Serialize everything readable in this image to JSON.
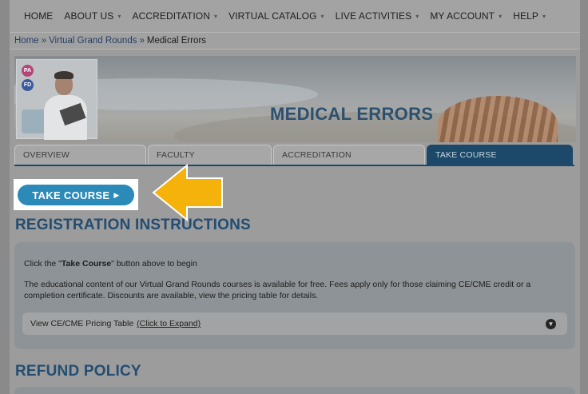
{
  "nav": {
    "items": [
      {
        "label": "HOME",
        "caret": false
      },
      {
        "label": "ABOUT US",
        "caret": true
      },
      {
        "label": "ACCREDITATION",
        "caret": true
      },
      {
        "label": "VIRTUAL CATALOG",
        "caret": true
      },
      {
        "label": "LIVE ACTIVITIES",
        "caret": true
      },
      {
        "label": "MY ACCOUNT",
        "caret": true
      },
      {
        "label": "HELP",
        "caret": true
      }
    ],
    "caret_glyph": "▾"
  },
  "breadcrumb": {
    "home": "Home",
    "section": "Virtual Grand Rounds",
    "current": "Medical Errors",
    "separator": "»"
  },
  "banner": {
    "title": "MEDICAL ERRORS",
    "badge1": "PA",
    "badge2": "FD"
  },
  "tabs": [
    {
      "label": "OVERVIEW",
      "active": false
    },
    {
      "label": "FACULTY",
      "active": false
    },
    {
      "label": "ACCREDITATION",
      "active": false
    },
    {
      "label": "TAKE COURSE",
      "active": true
    }
  ],
  "take_course_button": {
    "label": "TAKE COURSE",
    "arrow": "▶"
  },
  "registration": {
    "title": "REGISTRATION INSTRUCTIONS",
    "line1_prefix": "Click the \"",
    "line1_bold": "Take Course",
    "line1_suffix": "\" button above to begin",
    "line2": "The educational content of our Virtual Grand Rounds courses is available for free. Fees apply only for those claiming CE/CME credit or a completion certificate. Discounts are available, view the pricing table for details.",
    "expand_label": "View CE/CME Pricing Table",
    "expand_link": "(Click to Expand)"
  },
  "refund": {
    "title": "REFUND POLICY"
  },
  "colors": {
    "accent": "#2b8ab8",
    "heading": "#234d72",
    "arrow": "#f5b20a"
  }
}
